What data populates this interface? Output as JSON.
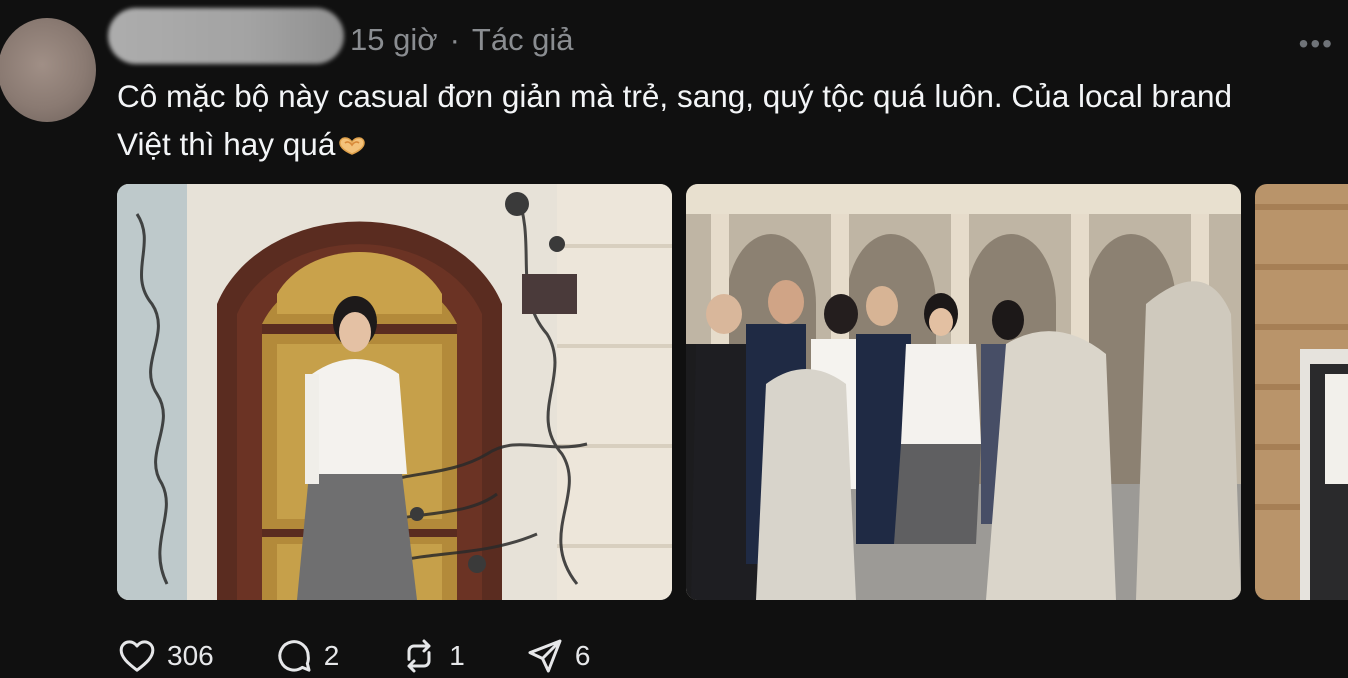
{
  "post": {
    "time": "15 giờ",
    "separator": "·",
    "author_tag": "Tác giả",
    "more_label": "•••",
    "caption_line1": "Cô mặc bộ này casual đơn giản mà trẻ, sang, quý tộc quá luôn. Của local brand",
    "caption_line2": "Việt thì hay quá",
    "emoji": "heart-hands-emoji"
  },
  "actions": {
    "likes": "306",
    "replies": "2",
    "reposts": "1",
    "shares": "6"
  },
  "icons": [
    "heart-icon",
    "comment-icon",
    "repost-icon",
    "send-icon"
  ],
  "colors": {
    "background": "#101010",
    "text": "#f3f5f7",
    "muted": "#8a8d91"
  }
}
